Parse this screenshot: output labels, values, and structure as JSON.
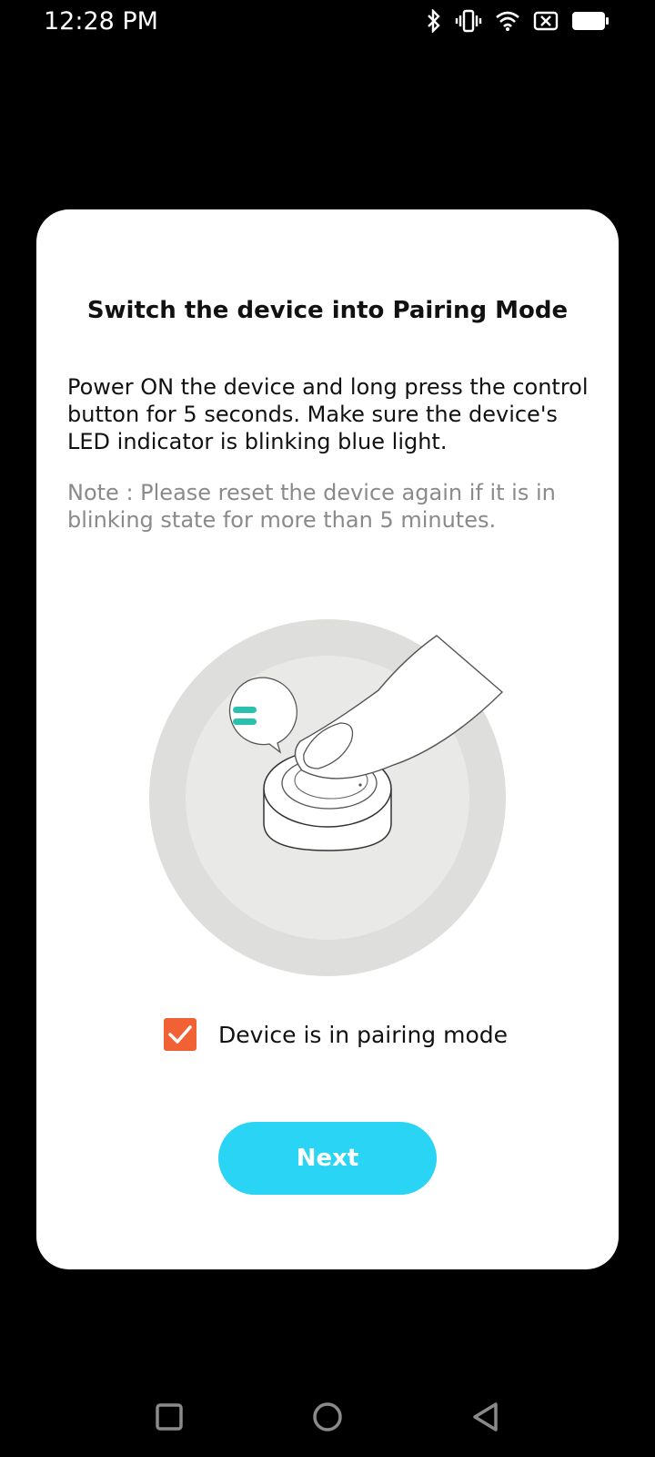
{
  "status_bar": {
    "time": "12:28 PM",
    "icons": [
      "bluetooth-icon",
      "vibrate-icon",
      "wifi-icon",
      "no-sim-icon",
      "battery-icon"
    ]
  },
  "dialog": {
    "title": "Switch the device into Pairing Mode",
    "body": "Power ON the device and long press the control button for 5 seconds. Make sure the device's LED indicator is blinking blue light.",
    "note": "Note : Please reset the device again if it is in blinking state for more than 5 minutes.",
    "checkbox": {
      "label": "Device is in pairing mode",
      "checked": true,
      "color": "#f26134"
    },
    "next_button": {
      "label": "Next",
      "color": "#29d4f5"
    }
  },
  "nav_bar": {
    "buttons": [
      "recents-icon",
      "home-icon",
      "back-icon"
    ]
  }
}
